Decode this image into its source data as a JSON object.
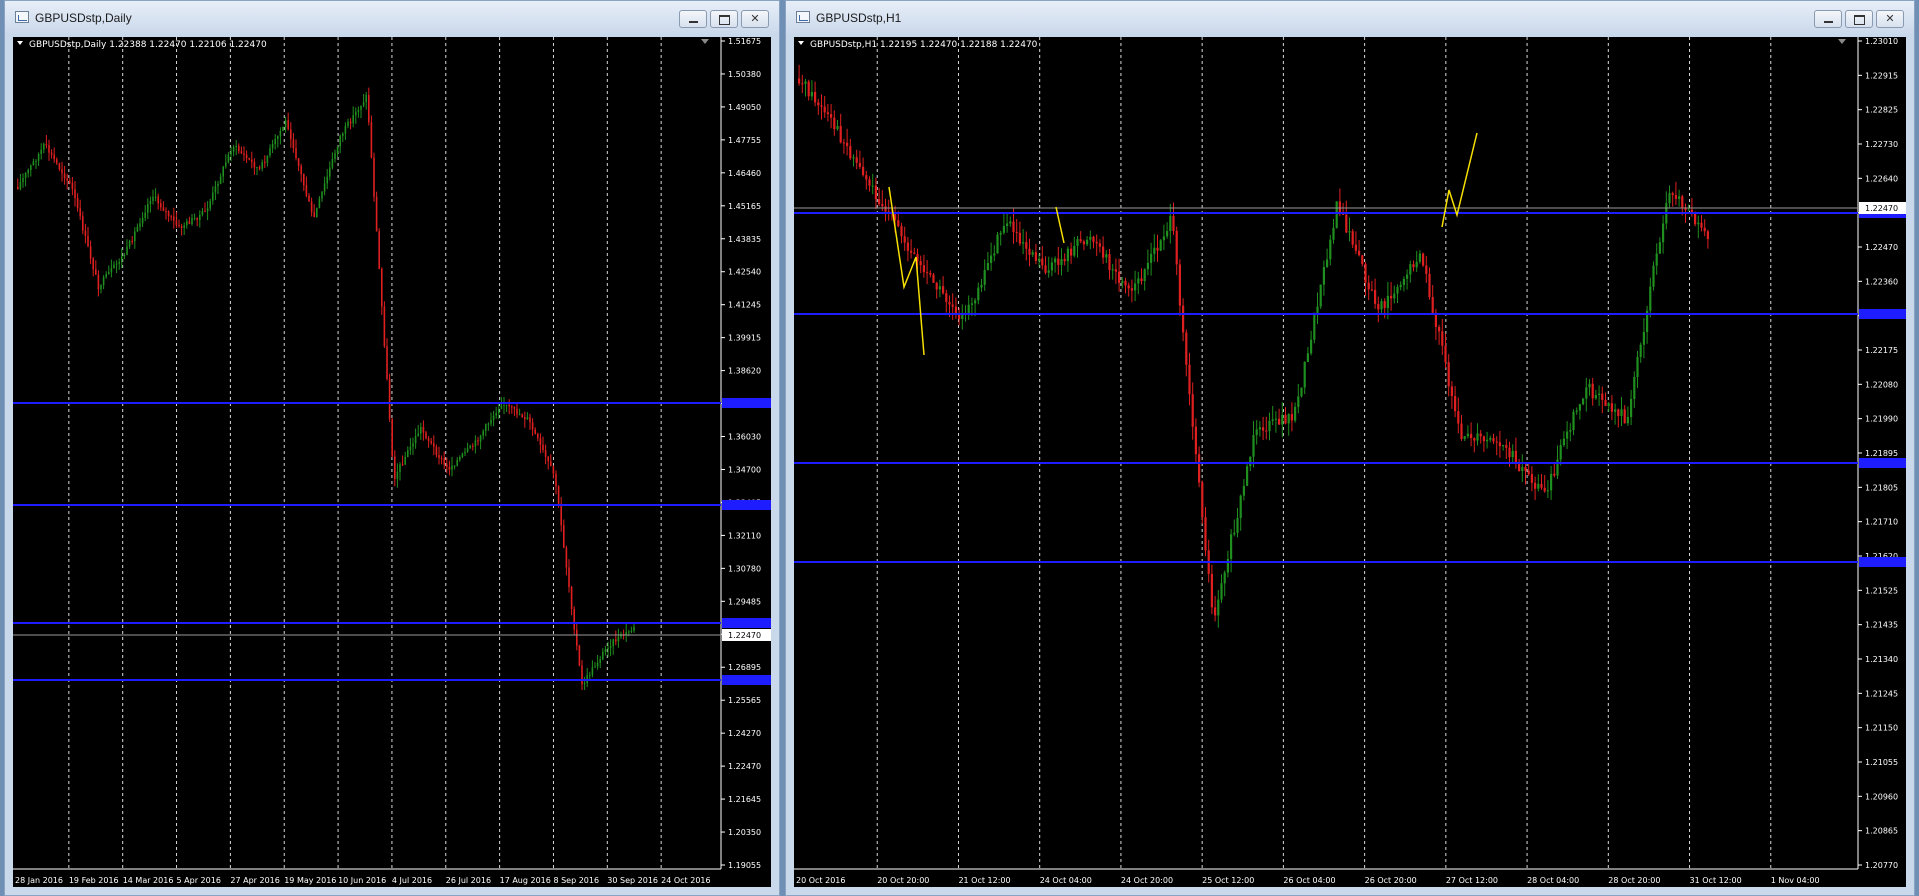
{
  "windows": [
    {
      "title": "GBPUSDstp,Daily",
      "header": "GBPUSDstp,Daily  1.22388 1.22470 1.22106 1.22470",
      "price_labels": [
        "1.51675",
        "1.50380",
        "1.49050",
        "1.47755",
        "1.46460",
        "1.45165",
        "1.43835",
        "1.42540",
        "1.41245",
        "1.39915",
        "1.38620",
        "1.37325",
        "1.36030",
        "1.34700",
        "1.33405",
        "1.32110",
        "1.30780",
        "1.29485",
        "1.28190",
        "1.26895",
        "1.25565",
        "1.24270",
        "1.22470",
        "1.21645",
        "1.20350",
        "1.19055"
      ],
      "current_price": "1.22470",
      "date_labels": [
        "28 Jan 2016",
        "19 Feb 2016",
        "14 Mar 2016",
        "5 Apr 2016",
        "27 Apr 2016",
        "19 May 2016",
        "10 Jun 2016",
        "4 Jul 2016",
        "26 Jul 2016",
        "17 Aug 2016",
        "8 Sep 2016",
        "30 Sep 2016",
        "24 Oct 2016"
      ]
    },
    {
      "title": "GBPUSDstp,H1",
      "header": "GBPUSDstp,H1  1.22195 1.22470 1.22188 1.22470",
      "price_labels": [
        "1.23010",
        "1.22915",
        "1.22825",
        "1.22730",
        "1.22640",
        "1.22545",
        "1.22470",
        "1.22360",
        "1.22270",
        "1.22175",
        "1.22080",
        "1.21990",
        "1.21895",
        "1.21805",
        "1.21710",
        "1.21620",
        "1.21525",
        "1.21435",
        "1.21340",
        "1.21245",
        "1.21150",
        "1.21055",
        "1.20960",
        "1.20865",
        "1.20770"
      ],
      "current_price": "1.22470",
      "date_labels": [
        "20 Oct 2016",
        "20 Oct 20:00",
        "21 Oct 12:00",
        "24 Oct 04:00",
        "24 Oct 20:00",
        "25 Oct 12:00",
        "26 Oct 04:00",
        "26 Oct 20:00",
        "27 Oct 12:00",
        "28 Oct 04:00",
        "28 Oct 20:00",
        "31 Oct 12:00",
        "1 Nov 04:00"
      ]
    }
  ],
  "colors": {
    "bull": "#1f8f1f",
    "bear": "#e02020",
    "level": "#1d1dff",
    "grid": "#ffffff",
    "drawing": "#f5e000"
  }
}
